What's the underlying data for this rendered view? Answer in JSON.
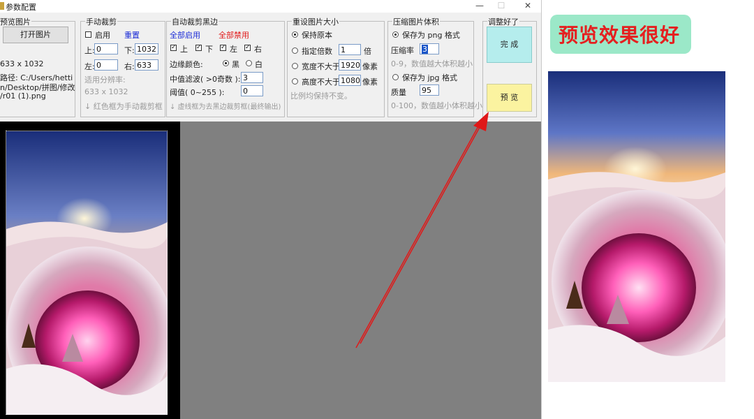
{
  "window": {
    "title": "参数配置",
    "minimize": "—",
    "maximize": "☐",
    "close": "✕"
  },
  "preview_group": {
    "title": "预览图片",
    "open_button": "打开图片",
    "size": "633 x 1032",
    "path_line1": "路径:  C:/Users/hetti",
    "path_line2": "n/Desktop/拼图/修改",
    "path_line3": "/r01 (1).png"
  },
  "manual_crop": {
    "title": "手动裁剪",
    "enable_label": "启用",
    "reset_label": "重置",
    "top_label": "上:",
    "top_value": "0",
    "bottom_label": "下:",
    "bottom_value": "1032",
    "left_label": "左:",
    "left_value": "0",
    "right_label": "右:",
    "right_value": "633",
    "resolution_label": "适用分辨率:",
    "resolution_value": "633 x 1032",
    "hint": "↓ 红色框为手动裁剪框"
  },
  "auto_crop": {
    "title": "自动裁剪黑边",
    "enable_all": "全部启用",
    "disable_all": "全部禁用",
    "sides": [
      "上",
      "下",
      "左",
      "右"
    ],
    "edge_color_label": "边缘颜色:",
    "black_label": "黑",
    "white_label": "白",
    "median_label": "中值滤波( >0奇数 ):",
    "median_value": "3",
    "threshold_label": "阈值( 0~255 ):",
    "threshold_value": "0",
    "hint": "↓ 虚线框为去黑边裁剪框(最终输出)"
  },
  "resize": {
    "title": "重设图片大小",
    "keep_original": "保持原本",
    "multiple_label": "指定倍数",
    "multiple_value": "1",
    "multiple_unit": "倍",
    "width_label": "宽度不大于",
    "width_value": "1920",
    "width_unit": "像素",
    "height_label": "高度不大于",
    "height_value": "1080",
    "height_unit": "像素",
    "hint": "比例均保持不变。"
  },
  "compress": {
    "title": "压缩图片体积",
    "png_label": "保存为 png 格式",
    "png_rate_label": "压缩率",
    "png_rate_value": "3",
    "png_hint": "0-9，数值越大体积越小",
    "jpg_label": "保存为 jpg 格式",
    "quality_label": "质量",
    "quality_value": "95",
    "jpg_hint": "0-100，数值越小体积越小"
  },
  "adjust": {
    "title": "调整好了",
    "done_button": "完 成",
    "preview_button": "预 览"
  },
  "annotation": {
    "text": "预览效果很好"
  },
  "colors": {
    "accent_blue": "#1a2bd6",
    "accent_red": "#e01818",
    "done_bg": "#b5eded",
    "preview_bg": "#fbf3a0",
    "badge_bg": "#9be8c8"
  }
}
